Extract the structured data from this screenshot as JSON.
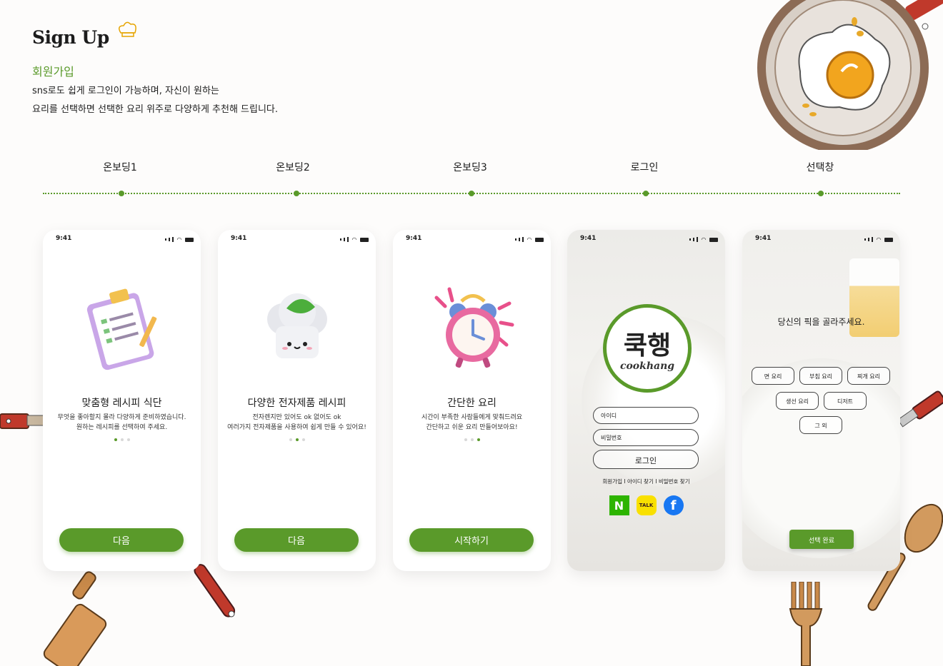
{
  "header": {
    "title": "Sign Up",
    "subtitle": "회원가입",
    "desc_line1": "sns로도 쉽게 로그인이 가능하며, 자신이 원하는",
    "desc_line2": "요리를 선택하면 선택한 요리 위주로 다양하게 추천해 드립니다."
  },
  "steps": [
    "온보딩1",
    "온보딩2",
    "온보딩3",
    "로그인",
    "선택창"
  ],
  "status_time": "9:41",
  "onboarding": [
    {
      "title": "맞춤형 레시피 식단",
      "line1": "무엇을 좋아할지 몰라 다양하게 준비하였습니다.",
      "line2": "원하는 레시피를 선택하여 주세요.",
      "button": "다음",
      "page": 1
    },
    {
      "title": "다양한 전자제품 레시피",
      "line1": "전자렌지만 있어도 ok 없어도 ok",
      "line2": "여러가지 전자제품을 사용하여 쉽게 만들 수 있어요!",
      "button": "다음",
      "page": 2
    },
    {
      "title": "간단한 요리",
      "line1": "시간이 부족한 사람들에게 맞춰드려요",
      "line2": "간단하고 쉬운 요리 만들어보아요!",
      "button": "시작하기",
      "page": 3
    }
  ],
  "login": {
    "logo_kr": "쿡행",
    "logo_en": "cookhang",
    "id_placeholder": "아이디",
    "pw_placeholder": "비밀번호",
    "button": "로그인",
    "links": "회원가입 I 아이디 찾기 I 비밀번호 찾기",
    "social": {
      "naver": "N",
      "kakao": "TALK",
      "facebook": "f"
    }
  },
  "select": {
    "title": "당신의 픽을 골라주세요.",
    "chips": [
      "면 요리",
      "부침 요리",
      "찌개 요리",
      "생선 요리",
      "디저트",
      "그 외"
    ],
    "done": "선택 완료"
  },
  "colors": {
    "accent": "#5a9a2a",
    "naver": "#2db400",
    "kakao": "#f9e000",
    "facebook": "#1877f2"
  }
}
